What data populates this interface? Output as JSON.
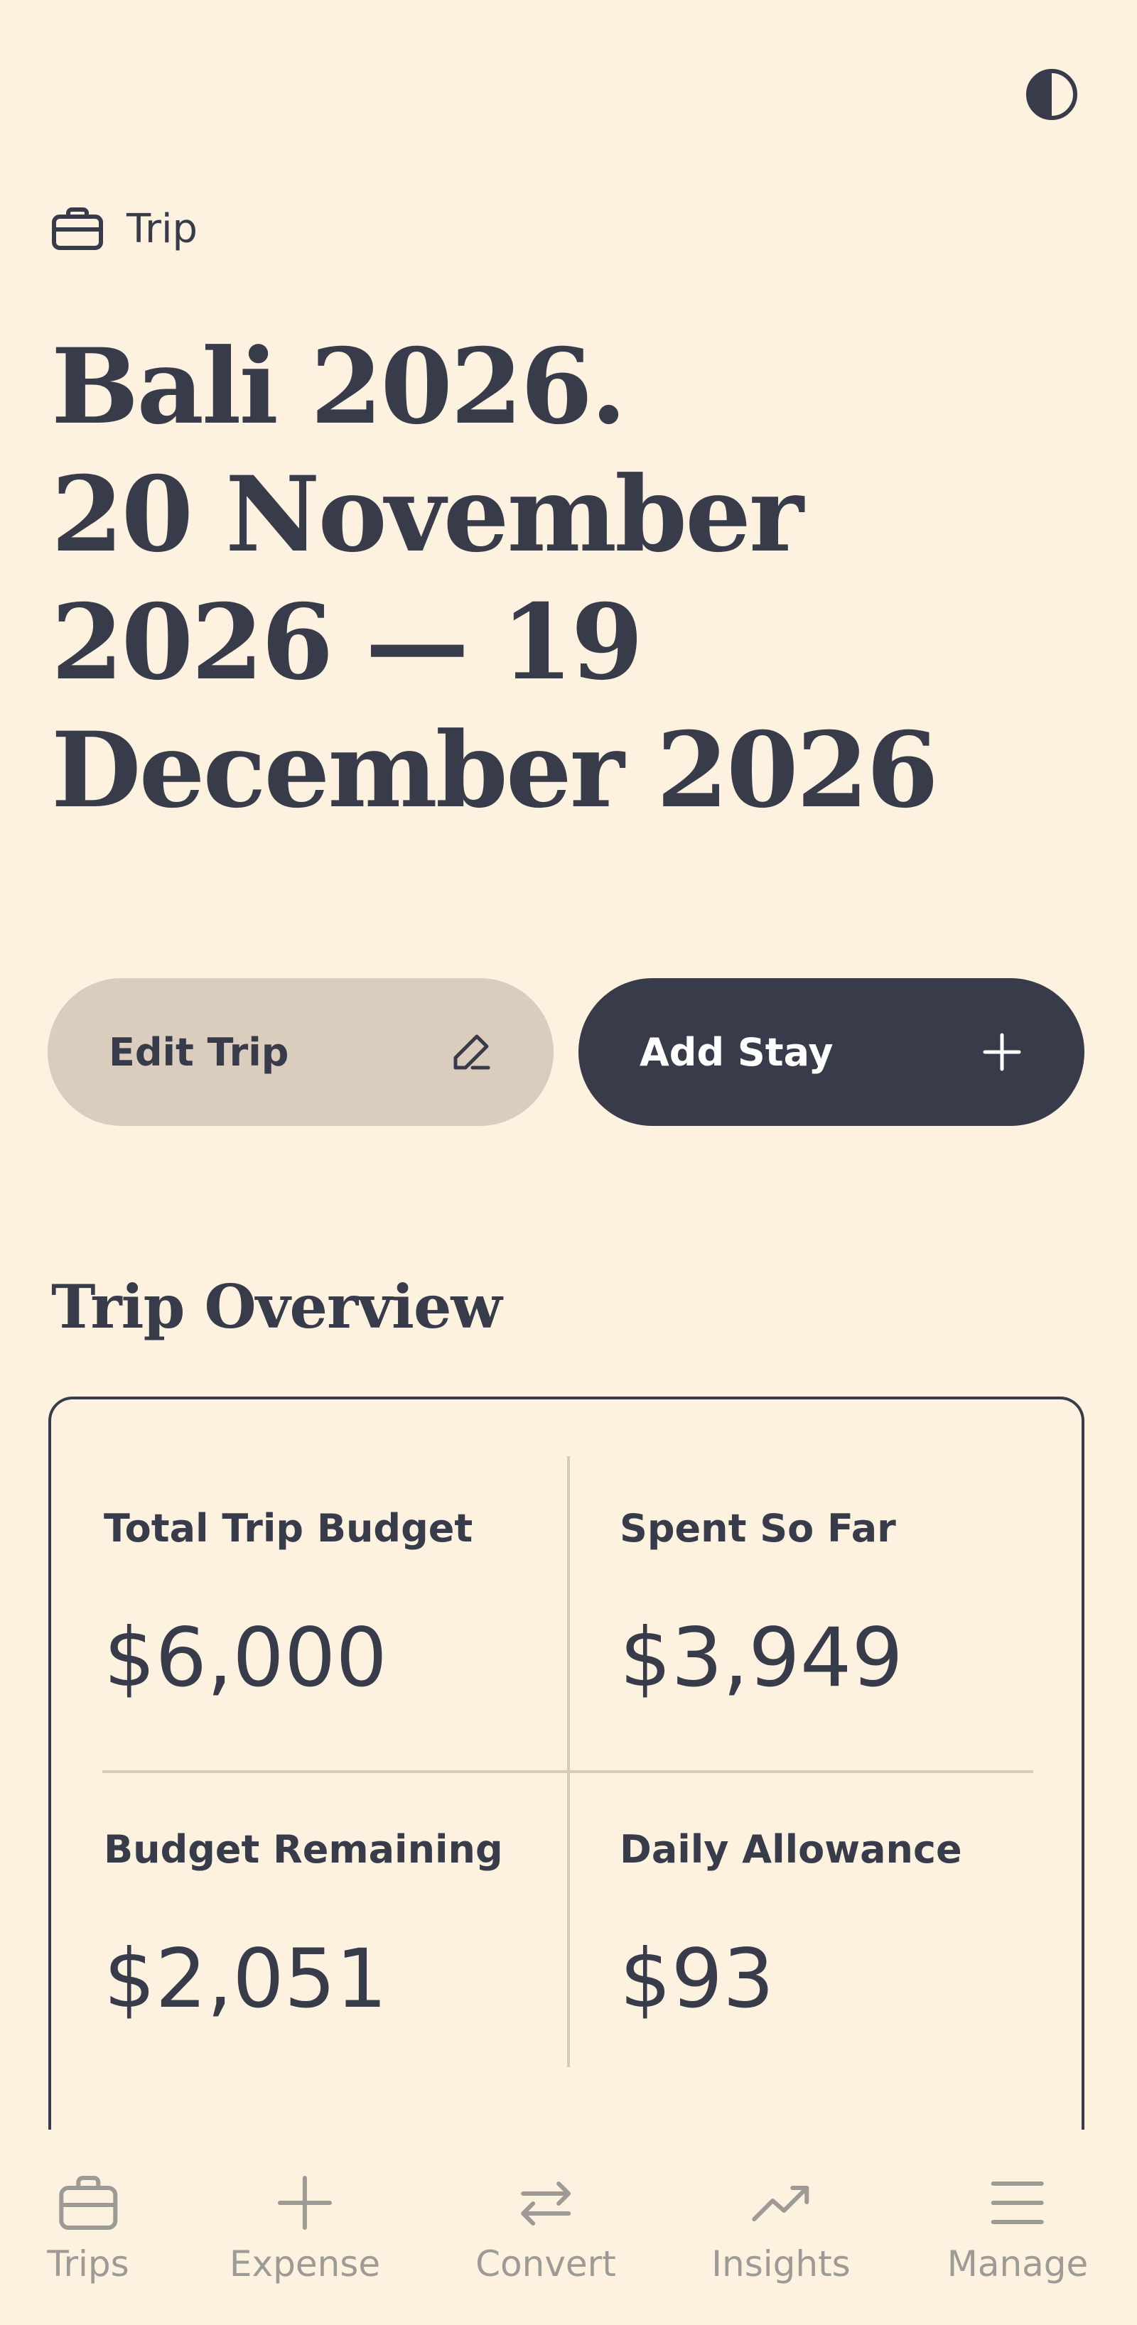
{
  "header": {
    "theme_toggle_icon": "contrast-half-circle-icon",
    "eyebrow_icon": "briefcase-icon",
    "eyebrow_label": "Trip",
    "title_lines": [
      "Bali 2026.",
      "20 November",
      "2026 — 19",
      "December 2026"
    ]
  },
  "actions": {
    "edit_label": "Edit Trip",
    "edit_icon": "pencil-icon",
    "add_label": "Add Stay",
    "add_icon": "plus-icon"
  },
  "overview": {
    "title": "Trip Overview",
    "stats": [
      {
        "label": "Total Trip Budget",
        "value": "$6,000"
      },
      {
        "label": "Spent So Far",
        "value": "$3,949"
      },
      {
        "label": "Budget Remaining",
        "value": "$2,051"
      },
      {
        "label": "Daily Allowance",
        "value": "$93"
      }
    ]
  },
  "tabbar": {
    "tabs": [
      {
        "label": "Trips",
        "icon": "briefcase-icon"
      },
      {
        "label": "Expense",
        "icon": "plus-icon"
      },
      {
        "label": "Convert",
        "icon": "swap-arrows-icon"
      },
      {
        "label": "Insights",
        "icon": "trend-up-icon"
      },
      {
        "label": "Manage",
        "icon": "menu-icon"
      }
    ]
  },
  "colors": {
    "background": "#fdf1df",
    "ink": "#383c4a",
    "secondary_button": "#dacdbd",
    "divider": "#d7cab9",
    "tab_inactive": "#9e9a95"
  }
}
